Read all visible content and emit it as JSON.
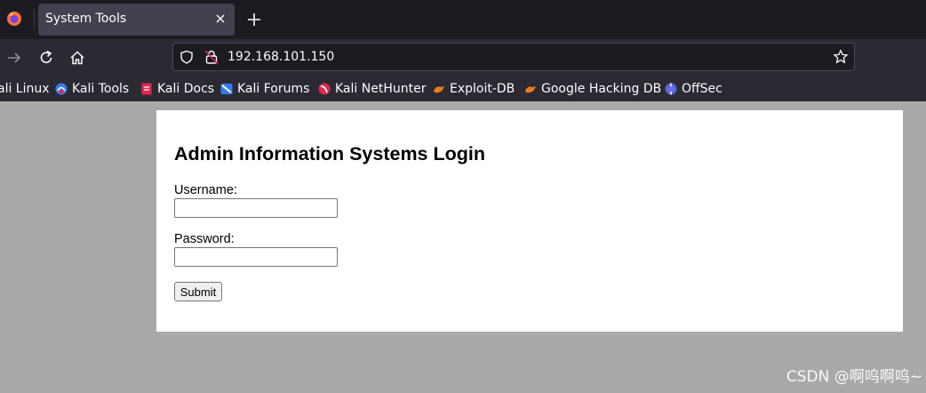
{
  "browser": {
    "tab": {
      "title": "System Tools"
    },
    "url": "192.168.101.150",
    "bookmarks": [
      {
        "label": "ali Linux",
        "icon": "kali-icon"
      },
      {
        "label": "Kali Tools",
        "icon": "kali-tools-icon"
      },
      {
        "label": "Kali Docs",
        "icon": "kali-docs-icon"
      },
      {
        "label": "Kali Forums",
        "icon": "kali-forums-icon"
      },
      {
        "label": "Kali NetHunter",
        "icon": "kali-nethunter-icon"
      },
      {
        "label": "Exploit-DB",
        "icon": "exploit-db-icon"
      },
      {
        "label": "Google Hacking DB",
        "icon": "exploit-db-icon"
      },
      {
        "label": "OffSec",
        "icon": "offsec-icon"
      }
    ]
  },
  "page": {
    "heading": "Admin Information Systems Login",
    "username_label": "Username:",
    "username_value": "",
    "password_label": "Password:",
    "password_value": "",
    "submit_label": "Submit"
  },
  "watermark": "CSDN @啊呜啊呜~",
  "colors": {
    "tabstrip_bg": "#1c1b22",
    "toolbar_bg": "#2b2a33",
    "page_bg": "#a9a9a9",
    "card_bg": "#ffffff"
  }
}
